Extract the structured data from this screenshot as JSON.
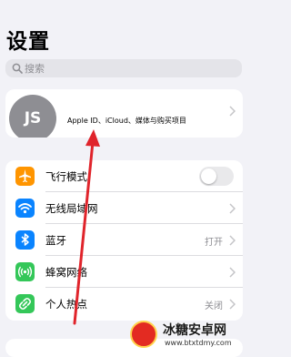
{
  "header": {
    "title": "设置"
  },
  "search": {
    "placeholder": "搜索"
  },
  "account": {
    "avatar_initials": "JS",
    "description": "Apple ID、iCloud、媒体与购买项目"
  },
  "settings": [
    {
      "label": "飞行模式",
      "icon": "airplane-icon",
      "color": "#ff9500",
      "toggle": false
    },
    {
      "label": "无线局域网",
      "icon": "wifi-icon",
      "color": "#0a84ff"
    },
    {
      "label": "蓝牙",
      "icon": "bluetooth-icon",
      "color": "#0a84ff",
      "value": "打开"
    },
    {
      "label": "蜂窝网络",
      "icon": "cellular-icon",
      "color": "#34c759"
    },
    {
      "label": "个人热点",
      "icon": "hotspot-icon",
      "color": "#34c759",
      "value": "关闭"
    }
  ],
  "annotation": {
    "arrow_color": "#e0242b"
  },
  "watermark": {
    "name": "冰糖安卓网",
    "url": "www.btxtdmy.com"
  }
}
